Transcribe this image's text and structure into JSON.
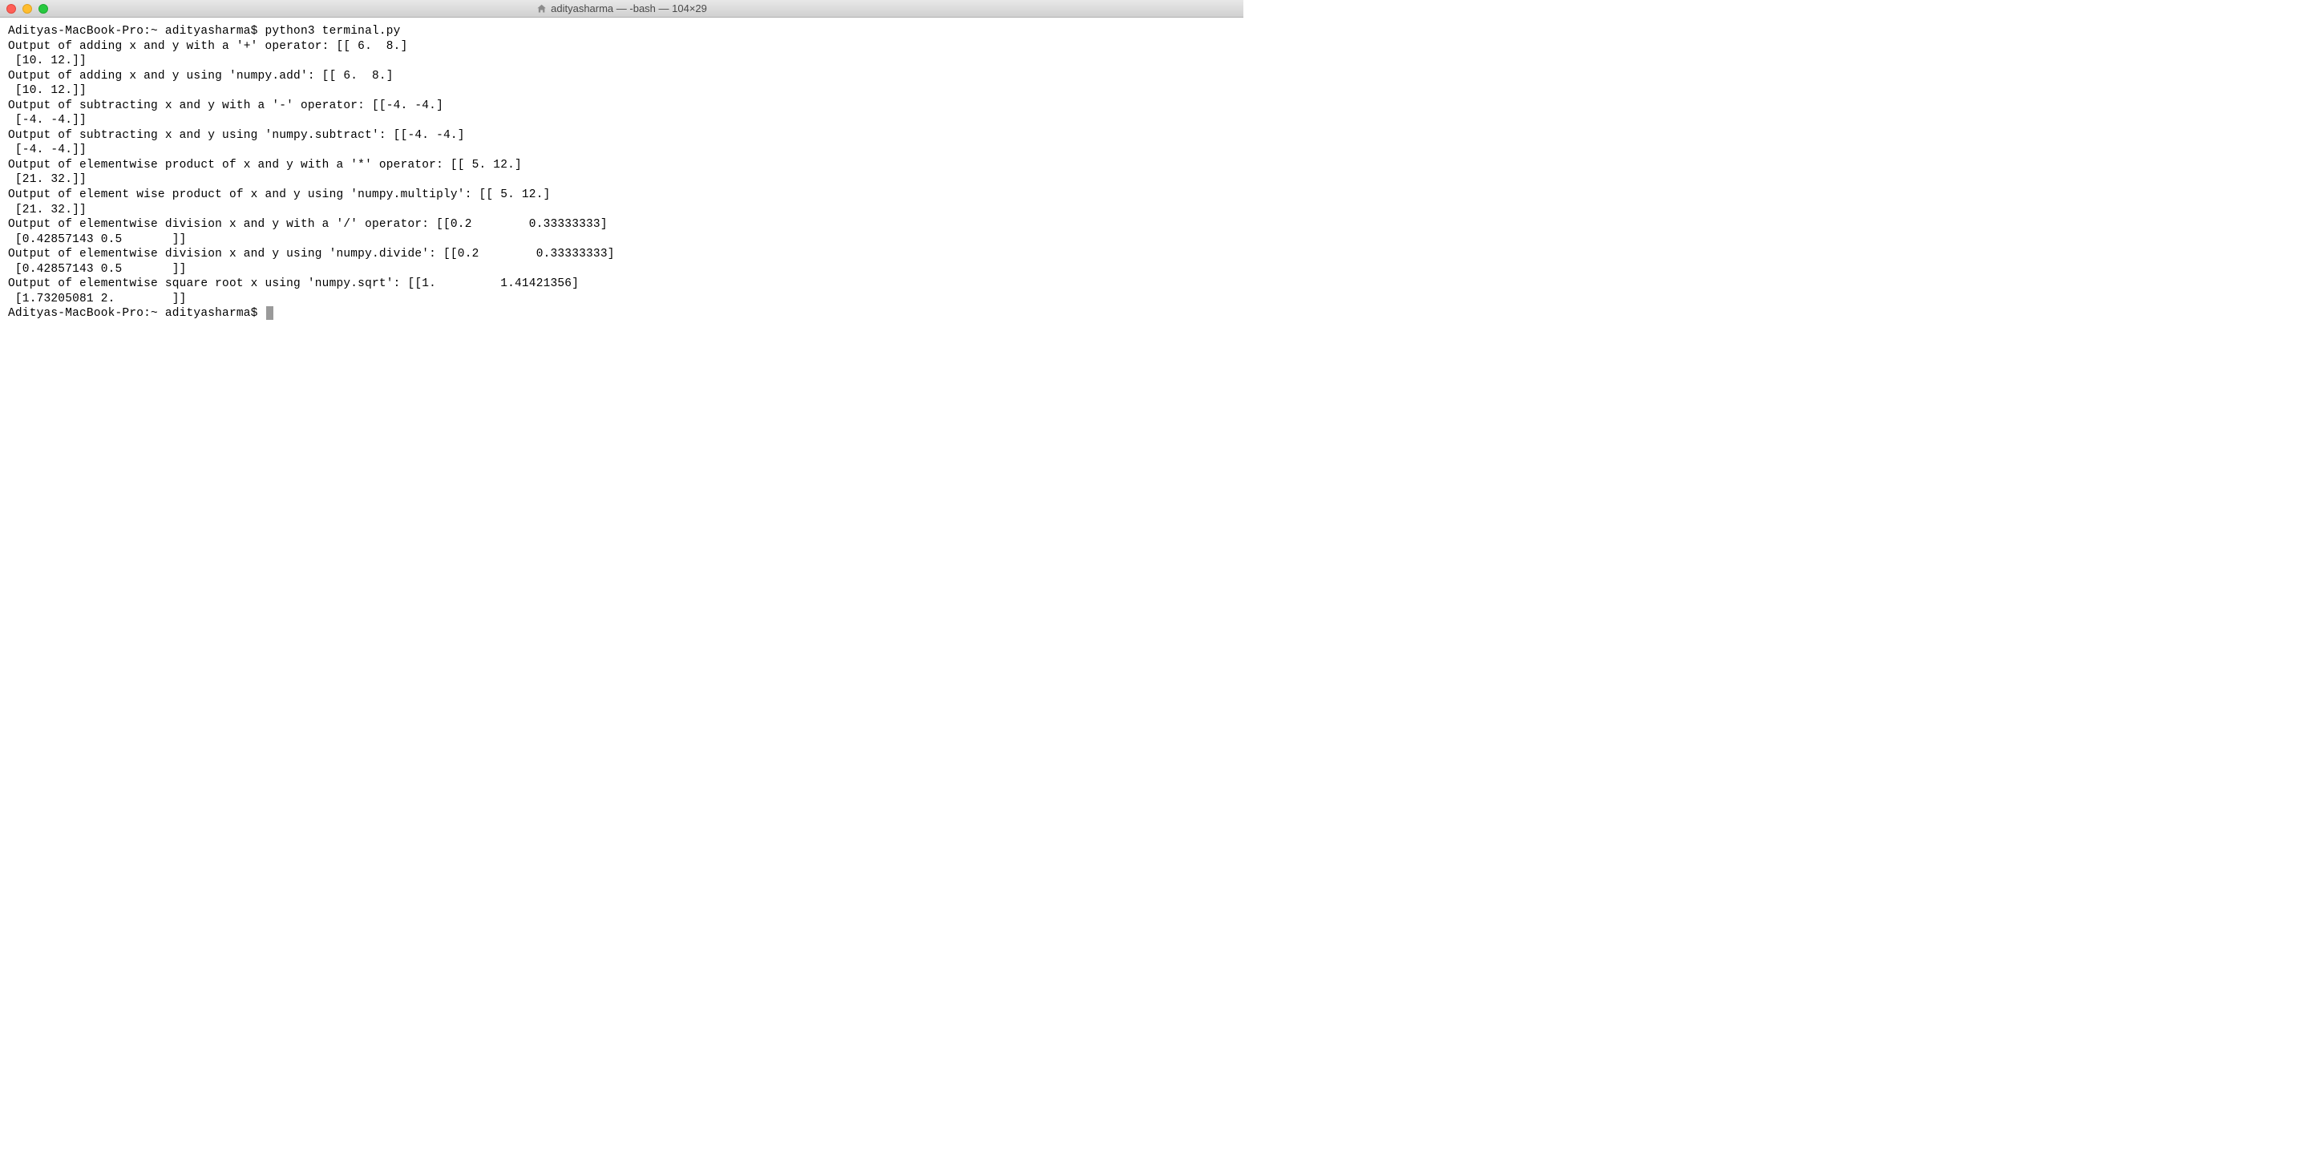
{
  "titlebar": {
    "title": "adityasharma — -bash — 104×29"
  },
  "terminal": {
    "prompt1": "Adityas-MacBook-Pro:~ adityasharma$ ",
    "command1": "python3 terminal.py",
    "output_lines": [
      "Output of adding x and y with a '+' operator: [[ 6.  8.]",
      " [10. 12.]]",
      "Output of adding x and y using 'numpy.add': [[ 6.  8.]",
      " [10. 12.]]",
      "Output of subtracting x and y with a '-' operator: [[-4. -4.]",
      " [-4. -4.]]",
      "Output of subtracting x and y using 'numpy.subtract': [[-4. -4.]",
      " [-4. -4.]]",
      "Output of elementwise product of x and y with a '*' operator: [[ 5. 12.]",
      " [21. 32.]]",
      "Output of element wise product of x and y using 'numpy.multiply': [[ 5. 12.]",
      " [21. 32.]]",
      "Output of elementwise division x and y with a '/' operator: [[0.2        0.33333333]",
      " [0.42857143 0.5       ]]",
      "Output of elementwise division x and y using 'numpy.divide': [[0.2        0.33333333]",
      " [0.42857143 0.5       ]]",
      "Output of elementwise square root x using 'numpy.sqrt': [[1.         1.41421356]",
      " [1.73205081 2.        ]]"
    ],
    "prompt2": "Adityas-MacBook-Pro:~ adityasharma$ "
  }
}
